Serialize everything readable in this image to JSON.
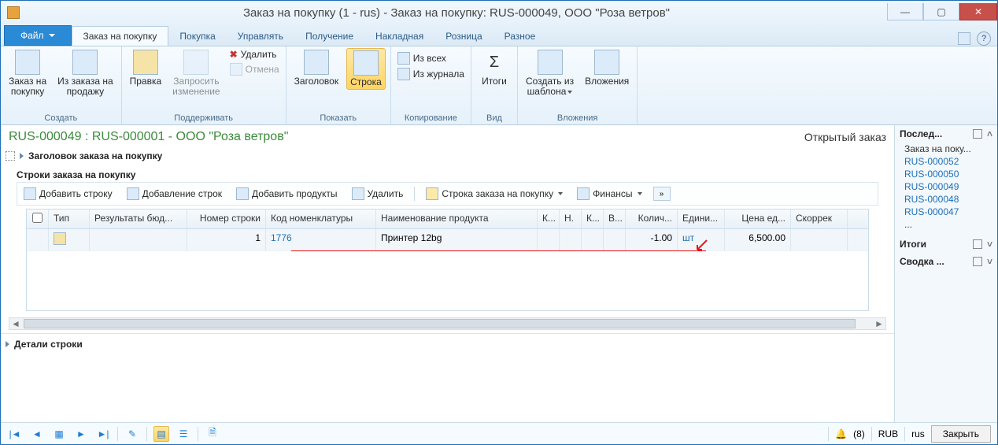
{
  "title": "Заказ на покупку (1 - rus) - Заказ на покупку: RUS-000049, ООО \"Роза ветров\"",
  "menu": {
    "file": "Файл",
    "tabs": [
      "Заказ на покупку",
      "Покупка",
      "Управлять",
      "Получение",
      "Накладная",
      "Розница",
      "Разное"
    ],
    "active": 0
  },
  "ribbon": {
    "groups": [
      {
        "label": "Создать",
        "items": [
          {
            "l1": "Заказ на",
            "l2": "покупку"
          },
          {
            "l1": "Из заказа на",
            "l2": "продажу"
          }
        ]
      },
      {
        "label": "Поддерживать",
        "items": [
          {
            "l1": "Правка"
          },
          {
            "l1": "Запросить",
            "l2": "изменение",
            "dis": true
          }
        ],
        "small": [
          {
            "t": "Удалить",
            "x": true
          },
          {
            "t": "Отмена",
            "x": false,
            "dis": true
          }
        ]
      },
      {
        "label": "Показать",
        "items": [
          {
            "l1": "Заголовок"
          },
          {
            "l1": "Строка",
            "sel": true
          }
        ]
      },
      {
        "label": "Копирование",
        "small": [
          {
            "t": "Из всех"
          },
          {
            "t": "Из журнала"
          }
        ]
      },
      {
        "label": "Вид",
        "items": [
          {
            "l1": "Итоги"
          }
        ]
      },
      {
        "label": "Вложения",
        "items": [
          {
            "l1": "Создать из",
            "l2": "шаблона",
            "dd": true
          },
          {
            "l1": "Вложения"
          }
        ]
      }
    ]
  },
  "subtitle": "RUS-000049 : RUS-000001 - ООО \"Роза ветров\"",
  "status": "Открытый заказ",
  "sections": {
    "header": "Заголовок заказа на покупку",
    "lines": "Строки заказа на покупку",
    "details": "Детали строки"
  },
  "toolbar": {
    "add_line": "Добавить строку",
    "add_lines": "Добавление строк",
    "add_products": "Добавить продукты",
    "delete": "Удалить",
    "po_line": "Строка заказа на покупку",
    "finance": "Финансы"
  },
  "gridcols": {
    "type": "Тип",
    "bud": "Результаты бюд...",
    "line": "Номер строки",
    "code": "Код номенклатуры",
    "name": "Наименование продукта",
    "k1": "К...",
    "n": "Н.",
    "k2": "К...",
    "v": "В...",
    "qty": "Колич...",
    "unit": "Едини...",
    "price": "Цена ед...",
    "corr": "Скоррек"
  },
  "gridrow": {
    "line": "1",
    "code": "1776",
    "name": "Принтер 12bg",
    "qty": "-1.00",
    "unit": "шт",
    "price": "6,500.00"
  },
  "right": {
    "recent_hdr": "Послед...",
    "recent_sub": "Заказ на поку...",
    "recent": [
      "RUS-000052",
      "RUS-000050",
      "RUS-000049",
      "RUS-000048",
      "RUS-000047"
    ],
    "dots": "...",
    "totals": "Итоги",
    "summary": "Сводка ..."
  },
  "bottom": {
    "bell_count": "(8)",
    "currency": "RUB",
    "lang": "rus",
    "close": "Закрыть"
  }
}
